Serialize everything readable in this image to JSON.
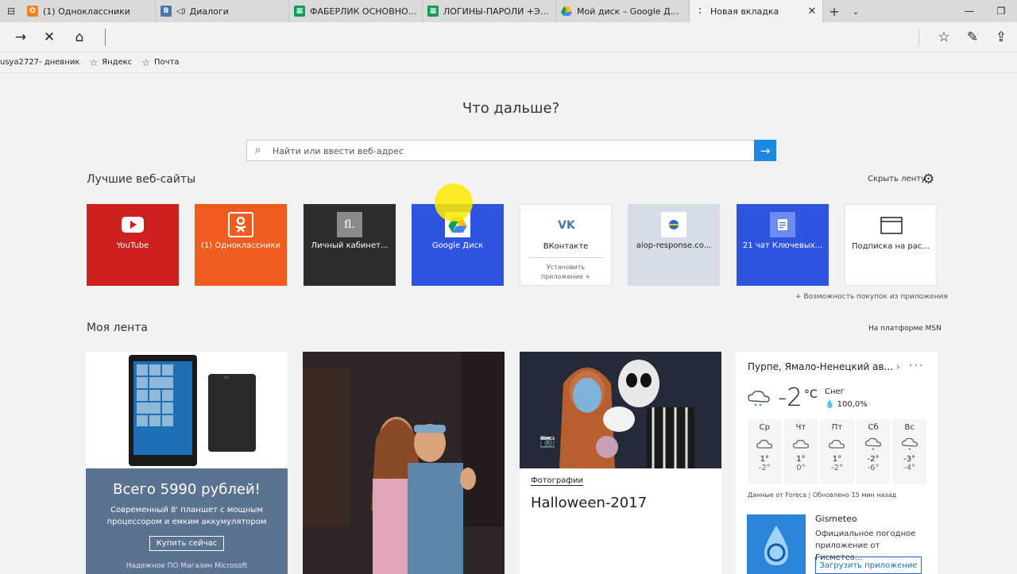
{
  "browser": {
    "tabs": [
      {
        "title": "(1) Одноклассники",
        "icon": "odnoklassniki-icon",
        "color": "#f58220"
      },
      {
        "title": "Диалоги",
        "icon": "vk-icon",
        "color": "#4a76a8"
      },
      {
        "title": "ФАБЕРЛИК ОСНОВНОЙ.xls",
        "icon": "sheets-icon",
        "color": "#0f9d58"
      },
      {
        "title": "ЛОГИНЫ-ПАРОЛИ +ЭКСП",
        "icon": "sheets-icon",
        "color": "#0f9d58"
      },
      {
        "title": "Мой диск – Google Диск",
        "icon": "google-drive-icon",
        "color": "#fbbc04"
      },
      {
        "title": "Новая вкладка",
        "icon": "loading-icon",
        "color": "#888888",
        "active": true
      }
    ],
    "favorites": [
      {
        "label": "usya2727- дневник"
      },
      {
        "label": "Яндекс"
      },
      {
        "label": "Почта"
      }
    ]
  },
  "page": {
    "headline": "Что дальше?",
    "search_placeholder": "Найти или ввести веб-адрес",
    "top_sites_title": "Лучшие веб-сайты",
    "hide_feed": "Скрыть ленту",
    "buy_note": "+ Возможность покупок из приложения",
    "feed_title": "Моя лента",
    "msn": "На платформе MSN"
  },
  "tiles": [
    {
      "label": "YouTube",
      "bg": "#cd201f",
      "color": "#ffffff",
      "icon": "youtube-icon"
    },
    {
      "label": "(1) Одноклассники",
      "bg": "#ee5c1e",
      "color": "#ffffff",
      "icon": "odnoklassniki-icon"
    },
    {
      "label": "Личный кабинет...",
      "bg": "#2d2d2d",
      "color": "#ffffff",
      "icon": "fl-icon",
      "icon_text": "fl."
    },
    {
      "label": "Google Диск",
      "bg": "#2f54e0",
      "color": "#ffffff",
      "icon": "google-drive-icon"
    },
    {
      "label": "ВКонтакте",
      "bg": "#ffffff",
      "color": "#222222",
      "icon": "vk-icon",
      "sub": "Установить приложение +"
    },
    {
      "label": "aiop-response.co...",
      "bg": "#d7dde6",
      "color": "#222222",
      "icon": "globe-icon"
    },
    {
      "label": "21 чат Ключевых...",
      "bg": "#2f54e0",
      "color": "#ffffff",
      "icon": "docs-icon"
    },
    {
      "label": "Подписка на рас...",
      "bg": "#ffffff",
      "color": "#222222",
      "icon": "window-icon"
    }
  ],
  "feed": {
    "ad": {
      "headline": "Всего 5990 рублей!",
      "text": "Современный 8' планшет с мощным процессором и емким аккумулятором",
      "button": "Купить сейчас",
      "footer": "Надежное ПО Магазин Microsoft"
    },
    "photo_card": {
      "category": "Фотографии",
      "title": "Halloween-2017"
    },
    "weather": {
      "location": "Пурпе, Ямало-Ненецкий ав...",
      "temp": "-2",
      "unit": "°C",
      "condition": "Снег",
      "precip": "100,0%",
      "days": [
        {
          "name": "Ср",
          "hi": "1°",
          "lo": "-2°",
          "icon": "cloud-icon"
        },
        {
          "name": "Чт",
          "hi": "1°",
          "lo": "0°",
          "icon": "cloud-icon"
        },
        {
          "name": "Пт",
          "hi": "1°",
          "lo": "-2°",
          "icon": "cloud-icon"
        },
        {
          "name": "Сб",
          "hi": "-2°",
          "lo": "-6°",
          "icon": "snow-cloud-icon"
        },
        {
          "name": "Вс",
          "hi": "-3°",
          "lo": "-4°",
          "icon": "snow-cloud-icon"
        }
      ],
      "source": "Данные от Foreca | Обновлено 15 мин назад",
      "app_name": "Gismeteo",
      "app_desc": "Официальное погодное приложение от Гисметео...",
      "app_button": "Загрузить приложение"
    }
  }
}
